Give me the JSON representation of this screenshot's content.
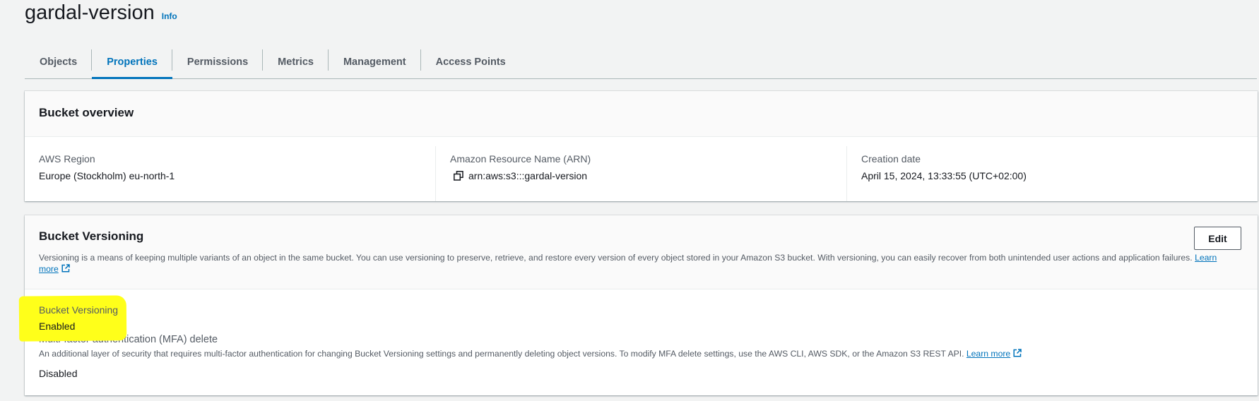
{
  "header": {
    "title": "gardal-version",
    "info_label": "Info"
  },
  "tabs": [
    {
      "label": "Objects",
      "active": false
    },
    {
      "label": "Properties",
      "active": true
    },
    {
      "label": "Permissions",
      "active": false
    },
    {
      "label": "Metrics",
      "active": false
    },
    {
      "label": "Management",
      "active": false
    },
    {
      "label": "Access Points",
      "active": false
    }
  ],
  "overview": {
    "title": "Bucket overview",
    "region_label": "AWS Region",
    "region_value": "Europe (Stockholm) eu-north-1",
    "arn_label": "Amazon Resource Name (ARN)",
    "arn_value": "arn:aws:s3:::gardal-version",
    "arn_icon": "copy-icon",
    "created_label": "Creation date",
    "created_value": "April 15, 2024, 13:33:55 (UTC+02:00)"
  },
  "versioning": {
    "title": "Bucket Versioning",
    "edit_label": "Edit",
    "description": "Versioning is a means of keeping multiple variants of an object in the same bucket. You can use versioning to preserve, retrieve, and restore every version of every object stored in your Amazon S3 bucket. With versioning, you can easily recover from both unintended user actions and application failures.",
    "learn_more_label": "Learn more",
    "status_label": "Bucket Versioning",
    "status_value": "Enabled",
    "mfa_label": "Multi-factor authentication (MFA) delete",
    "mfa_description": "An additional layer of security that requires multi-factor authentication for changing Bucket Versioning settings and permanently deleting object versions. To modify MFA delete settings, use the AWS CLI, AWS SDK, or the Amazon S3 REST API.",
    "mfa_learn_more_label": "Learn more",
    "mfa_value": "Disabled",
    "external_icon": "external-link-icon",
    "highlight_color": "#ffff1a"
  },
  "colors": {
    "accent": "#0073bb",
    "text": "#16191f",
    "muted": "#545b64",
    "background": "#f2f3f3"
  }
}
